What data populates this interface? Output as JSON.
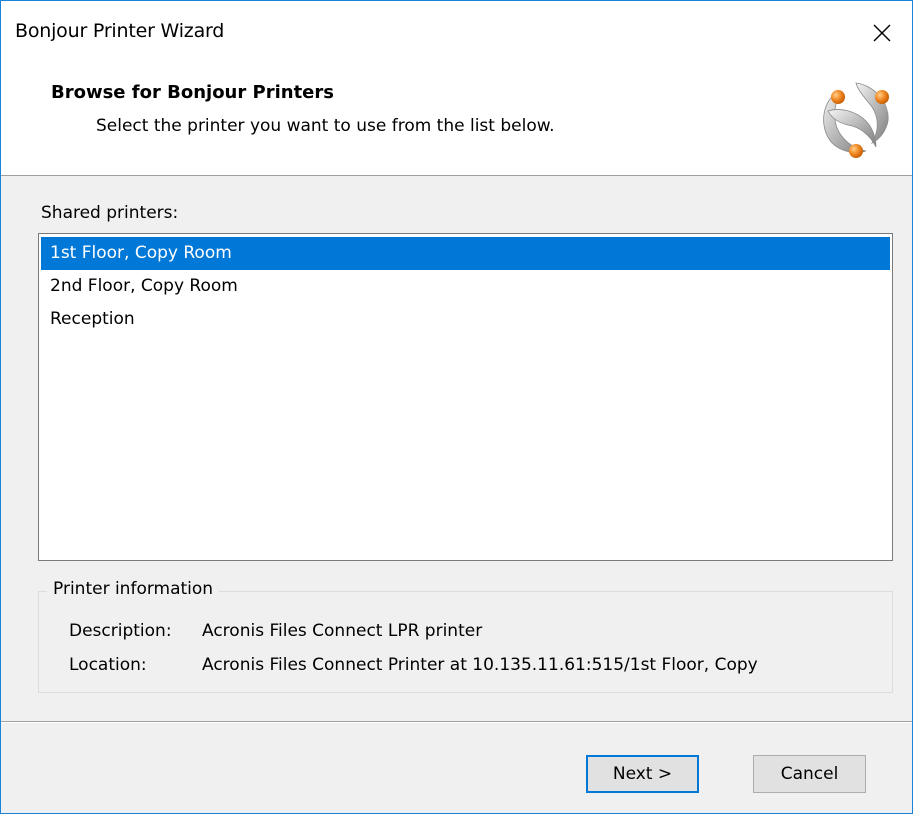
{
  "window": {
    "title": "Bonjour Printer Wizard",
    "close_glyph": "×"
  },
  "header": {
    "title": "Browse for Bonjour Printers",
    "subtitle": "Select the printer you want to use from the list below.",
    "logo_icon": "bonjour-logo-icon"
  },
  "printers": {
    "label": "Shared printers:",
    "items": [
      {
        "label": "1st Floor, Copy Room",
        "selected": true
      },
      {
        "label": "2nd Floor, Copy Room",
        "selected": false
      },
      {
        "label": "Reception",
        "selected": false
      }
    ]
  },
  "info": {
    "group_label": "Printer information",
    "description_label": "Description:",
    "description_value": "Acronis Files Connect LPR printer",
    "location_label": "Location:",
    "location_value": "Acronis Files Connect Printer at 10.135.11.61:515/1st Floor, Copy"
  },
  "buttons": {
    "next_label": "Next >",
    "cancel_label": "Cancel"
  },
  "colors": {
    "accent": "#0078d7",
    "window_border": "#1883d7",
    "logo_orange": "#f28a26"
  }
}
